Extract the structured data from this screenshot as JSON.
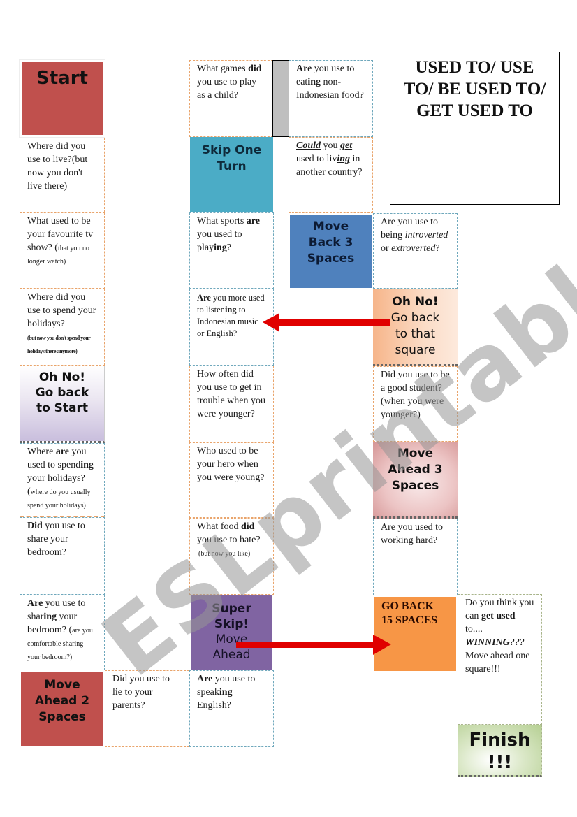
{
  "title": {
    "line1": "USED TO/ USE",
    "line2": "TO/ BE USED TO/",
    "line3": "GET USED TO"
  },
  "watermark": "ESLprintables.com",
  "colors": {
    "start": "#c0504d",
    "skip": "#4bacc6",
    "move_back": "#4f81bd",
    "go_back_orange": "#f79646",
    "super_skip": "#8064a2",
    "arrow": "#e00000"
  },
  "tiles": {
    "start": "Start",
    "q_live": "Where did you use to live?(but now you don't live there)",
    "q_tv_main": "What used to be your favourite tv show? (",
    "q_tv_small": "that you no longer watch)",
    "q_holidays_main": "Where did you use to spend your holidays?",
    "q_holidays_small": "(but now you don't spend your holidays there anymore)",
    "go_back_start": [
      "Oh No!",
      "Go back",
      "to Start"
    ],
    "q_spending_a": "Where ",
    "q_spending_b": "are",
    "q_spending_c": " you used to spend",
    "q_spending_d": "ing",
    "q_spending_e": " your holidays?(",
    "q_spending_small": "where do you usually spend your holidays)",
    "q_share_a": "Did",
    "q_share_b": " you use to share your bedroom?",
    "q_sharing_a": "Are",
    "q_sharing_b": " you use to shar",
    "q_sharing_c": "ing",
    "q_sharing_d": " your bedroom? (",
    "q_sharing_small": "are you comfortable sharing your bedroom?)",
    "move_ahead_2": [
      "Move",
      "Ahead 2",
      "Spaces"
    ],
    "q_lie": "Did you use to lie to your parents?",
    "q_speaking_a": "Are",
    "q_speaking_b": " you use to speak",
    "q_speaking_c": "ing",
    "q_speaking_d": " English?",
    "q_games_a": "What games ",
    "q_games_b": "did",
    "q_games_c": " you use to play as a child?",
    "skip_one": [
      "Skip One",
      "Turn"
    ],
    "q_sports_a": "What sports ",
    "q_sports_b": "are",
    "q_sports_c": " you used to play",
    "q_sports_d": "ing",
    "q_sports_e": "?",
    "q_listening_a": "Are",
    "q_listening_b": " you more used to listen",
    "q_listening_c": "ing",
    "q_listening_d": " to Indonesian music or English?",
    "q_trouble": "How often did you use to get in trouble when you were younger?",
    "q_hero": "Who used to be your hero when you were young?",
    "q_food_a": "What food ",
    "q_food_b": "did",
    "q_food_c": " you use to hate?",
    "q_food_small": "(but now you like)",
    "super_skip": [
      "Super",
      "Skip!",
      "Move",
      "Ahead"
    ],
    "q_eating_a": "Are",
    "q_eating_b": " you use to eat",
    "q_eating_c": "ing",
    "q_eating_d": " non-Indonesian food?",
    "q_country_a": "Could",
    "q_country_b": " you ",
    "q_country_c": "get",
    "q_country_d": " used to liv",
    "q_country_e": "ing",
    "q_country_f": " in another country?",
    "move_back_3": [
      "Move",
      "Back 3",
      "Spaces"
    ],
    "q_introvert_a": "Are you use to being ",
    "q_introvert_b": "introverted",
    "q_introvert_c": " or ",
    "q_introvert_d": "extroverted",
    "q_introvert_e": "?",
    "go_back_square": [
      "Oh No!",
      "Go back",
      "to that",
      "square"
    ],
    "q_student": "Did you use to be a good student? (when you were younger?)",
    "move_ahead_3": [
      "Move",
      "Ahead 3",
      "Spaces"
    ],
    "q_working": "Are you used to working hard?",
    "go_back_15": [
      "GO BACK",
      "15 SPACES"
    ],
    "q_winning_a": "Do you think you can ",
    "q_winning_b": "get used",
    "q_winning_c": " to....",
    "q_winning_d": "WINNING???",
    "q_winning_e": " Move ahead one square!!!",
    "finish": [
      "Finish",
      "!!!"
    ]
  }
}
